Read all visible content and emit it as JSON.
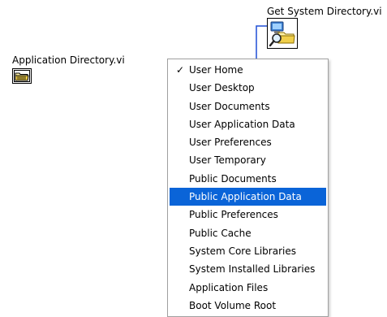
{
  "application_directory_vi": {
    "label": "Application Directory.vi",
    "icon": "folder-icon"
  },
  "get_system_directory_vi": {
    "label": "Get System Directory.vi",
    "icon": "system-folder-search-icon"
  },
  "colors": {
    "wire": "#1f4fd6",
    "menu_highlight": "#0a64d8",
    "menu_border": "#a0a0a0"
  },
  "menu": {
    "items": [
      {
        "label": "User Home",
        "checked": true,
        "highlighted": false
      },
      {
        "label": "User Desktop",
        "checked": false,
        "highlighted": false
      },
      {
        "label": "User Documents",
        "checked": false,
        "highlighted": false
      },
      {
        "label": "User Application Data",
        "checked": false,
        "highlighted": false
      },
      {
        "label": "User Preferences",
        "checked": false,
        "highlighted": false
      },
      {
        "label": "User Temporary",
        "checked": false,
        "highlighted": false
      },
      {
        "label": "Public Documents",
        "checked": false,
        "highlighted": false
      },
      {
        "label": "Public Application Data",
        "checked": false,
        "highlighted": true
      },
      {
        "label": "Public Preferences",
        "checked": false,
        "highlighted": false
      },
      {
        "label": "Public Cache",
        "checked": false,
        "highlighted": false
      },
      {
        "label": "System Core Libraries",
        "checked": false,
        "highlighted": false
      },
      {
        "label": "System Installed Libraries",
        "checked": false,
        "highlighted": false
      },
      {
        "label": "Application Files",
        "checked": false,
        "highlighted": false
      },
      {
        "label": "Boot Volume Root",
        "checked": false,
        "highlighted": false
      }
    ]
  }
}
